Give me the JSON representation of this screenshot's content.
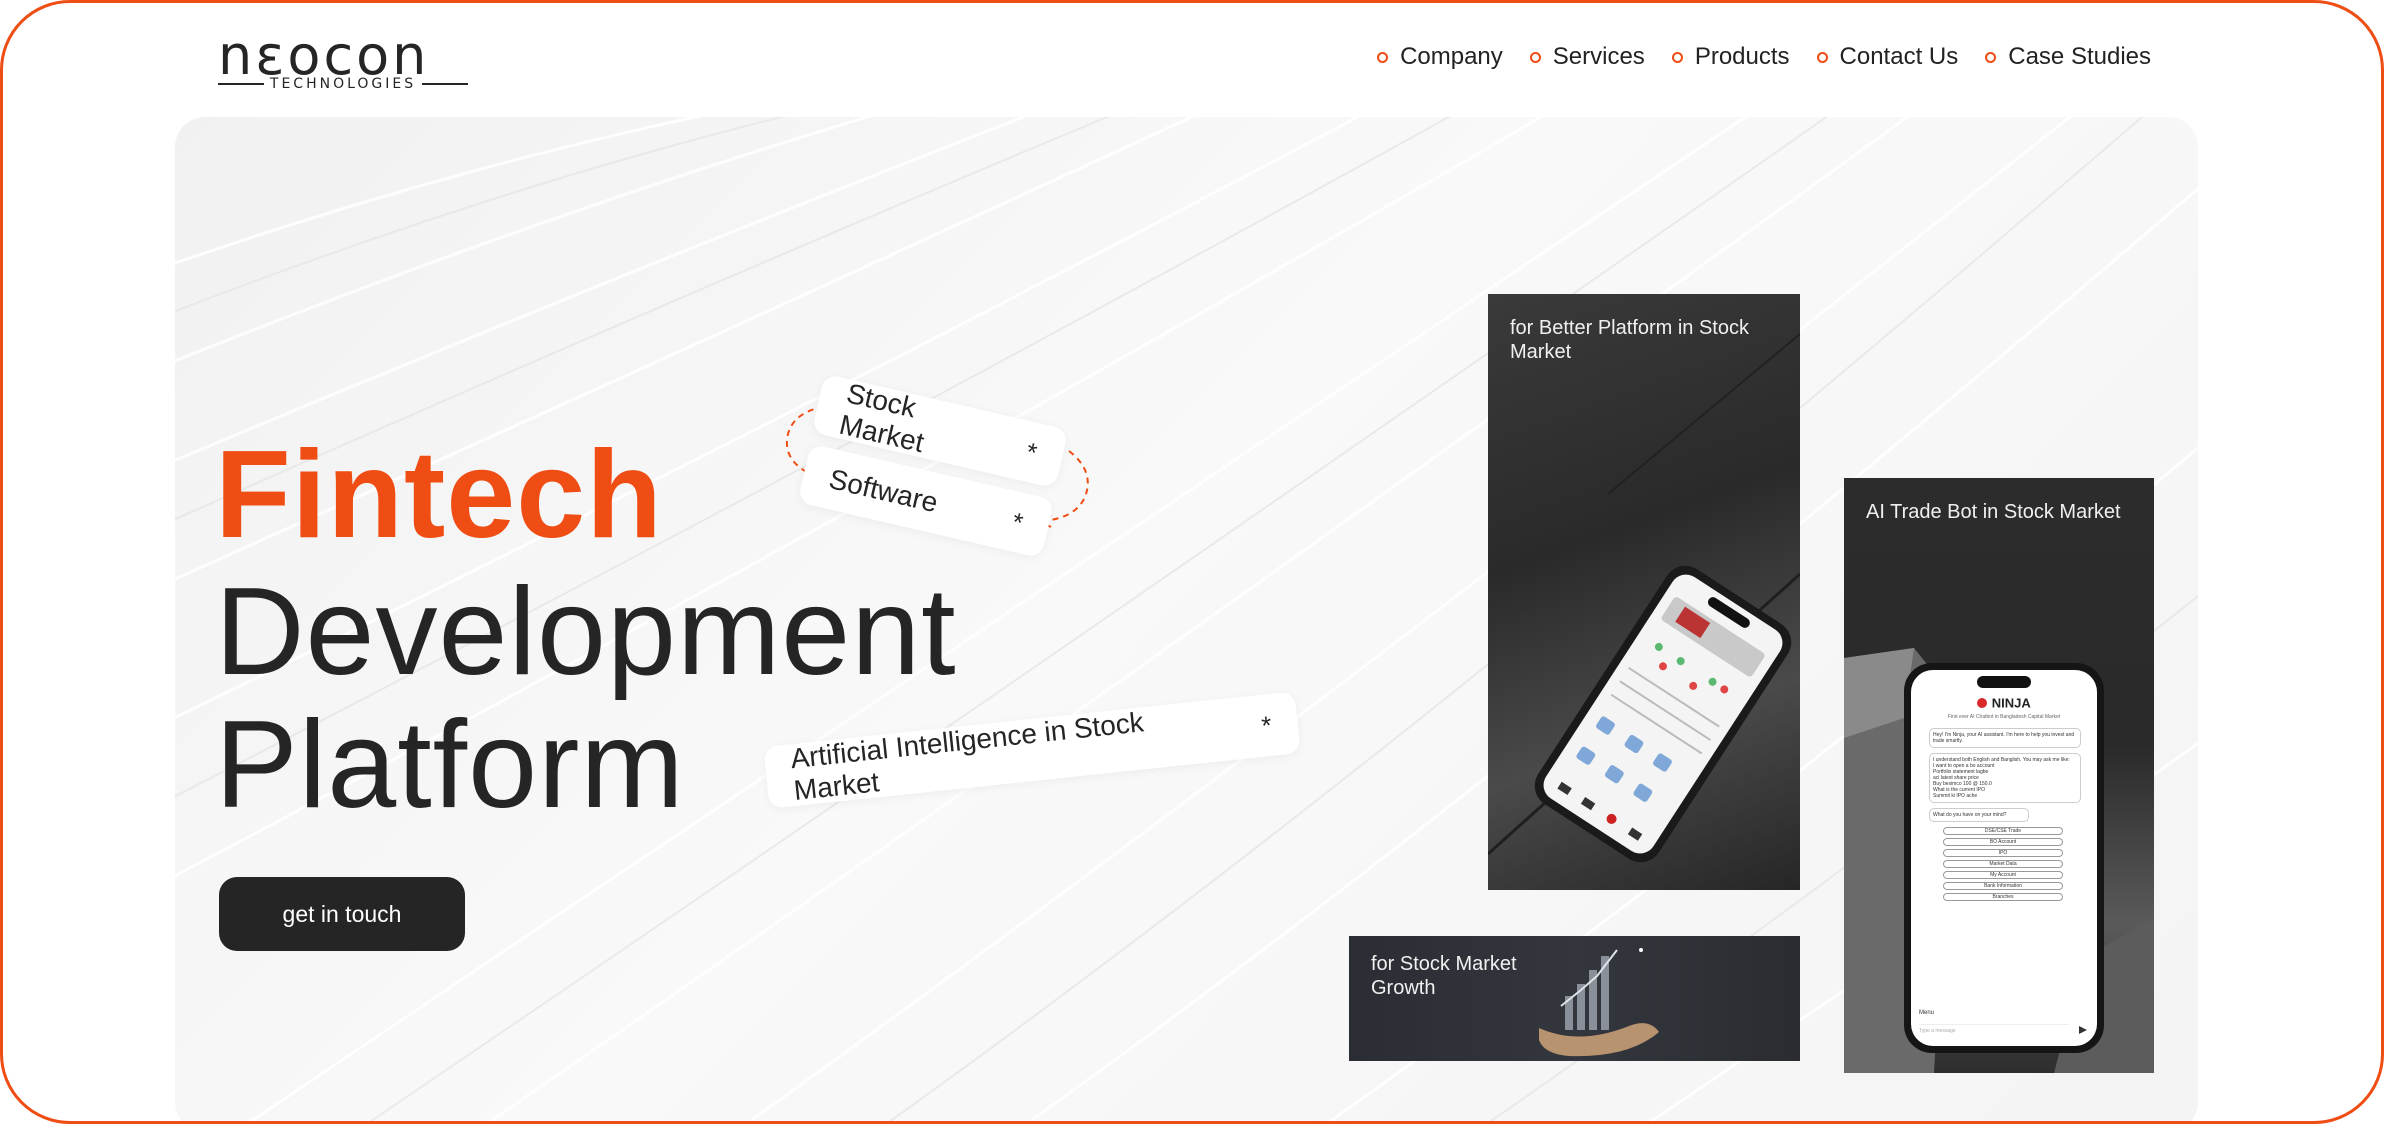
{
  "logo": {
    "word": "nεocon",
    "sub": "TECHNOLOGIES"
  },
  "nav": [
    {
      "label": "Company"
    },
    {
      "label": "Services"
    },
    {
      "label": "Products"
    },
    {
      "label": "Contact Us"
    },
    {
      "label": "Case Studies"
    }
  ],
  "hero": {
    "line1": "Fintech",
    "line2": "Development",
    "line3": "Platform",
    "cta": "get in touch"
  },
  "tags": [
    {
      "label": "Stock Market",
      "star": "*"
    },
    {
      "label": "Software",
      "star": "*"
    },
    {
      "label": "Artificial Intelligence in Stock Market",
      "star": "*"
    }
  ],
  "cards": [
    {
      "caption": "for Better Platform in Stock Market"
    },
    {
      "caption": "AI Trade Bot in Stock Market"
    },
    {
      "caption": "for Stock Market Growth"
    }
  ],
  "phone_bot": {
    "brand": "NINJA",
    "tagline": "First ever AI Chatbot in Bangladesh Capital Market",
    "greeting": "Hey! I'm Ninja, your AI assistant. I'm here to help you invest and trade smartly.",
    "intro": "I understand both English and Banglish. You may ask me like:",
    "examples": [
      "I want to open a bo account",
      "Portfolio statement lagbe",
      "aci latest share price",
      "Buy beximco 100 @ 150.0",
      "What is the current IPO",
      "Summit ki IPO ache"
    ],
    "question": "What do you have on your mind?",
    "options": [
      "DSE/CSE Trade",
      "BO Account",
      "IPO",
      "Market Data",
      "My Account",
      "Bank Information",
      "Branches"
    ],
    "menu": "Menu",
    "input_placeholder": "Type a message"
  },
  "colors": {
    "accent": "#ef4d14",
    "dark": "#252525"
  }
}
